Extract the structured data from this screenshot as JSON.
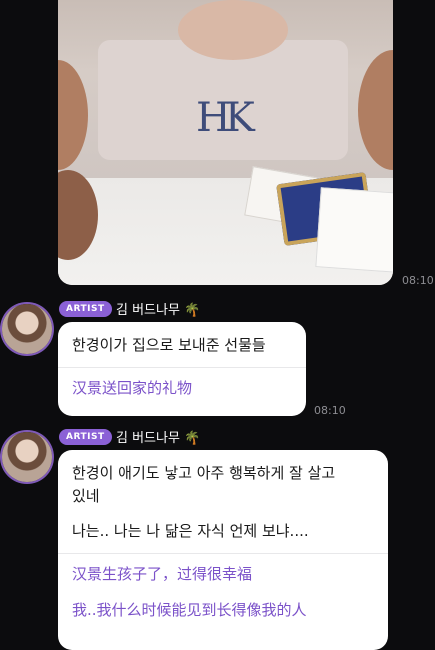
{
  "photo_message": {
    "time": "08:10",
    "image_desc_icon": "photo"
  },
  "messages": [
    {
      "badge": "ARTIST",
      "sender": "김 버드나무",
      "sender_emoji": "🌴",
      "korean": [
        "한경이가 집으로 보내준 선물들"
      ],
      "chinese": [
        "汉景送回家的礼物"
      ],
      "time": "08:10"
    },
    {
      "badge": "ARTIST",
      "sender": "김 버드나무",
      "sender_emoji": "🌴",
      "korean": [
        "한경이 애기도 낳고 아주 행복하게 잘 살고",
        "있네",
        "나는.. 나는 나 닮은 자식 언제 보냐...."
      ],
      "chinese": [
        "汉景生孩子了，过得很幸福",
        "我..我什么时候能见到长得像我的人"
      ]
    }
  ],
  "colors": {
    "accent": "#8b61d6",
    "translation": "#7b52c9",
    "background": "#0c0c0e"
  }
}
